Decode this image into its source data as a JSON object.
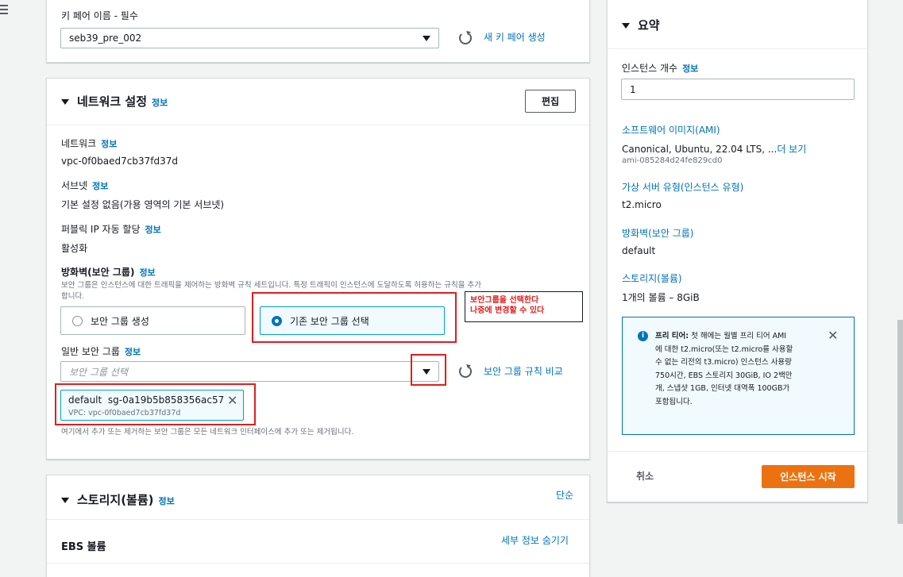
{
  "menu_icon": "hamburger-menu-icon",
  "keypair": {
    "label": "키 페어 이름 - 필수",
    "value": "seb39_pre_002",
    "create_link": "새 키 페어 생성"
  },
  "network": {
    "title": "네트워크 설정",
    "info": "정보",
    "edit_button": "편집",
    "network_label": "네트워크",
    "network_value": "vpc-0f0baed7cb37fd37d",
    "subnet_label": "서브넷",
    "subnet_value": "기본 설정 없음(가용 영역의 기본 서브넷)",
    "public_ip_label": "퍼블릭 IP 자동 할당",
    "public_ip_value": "활성화",
    "firewall_label": "방화벽(보안 그룹)",
    "firewall_desc_1": "보안 그룹은 인스턴스에 대한 트래픽을 제어하는 방화벽 규칙 세트입니다. 특정 트래픽이 인스턴스에 도달하도록 허용하는 규칙을 추가",
    "firewall_desc_2": "합니다.",
    "option_create": "보안 그룹 생성",
    "option_existing": "기존 보안 그룹 선택",
    "common_sg_label": "일반 보안 그룹",
    "sg_placeholder": "보안 그룹 선택",
    "compare_link": "보안 그룹 규칙 비교",
    "token_name": "default",
    "token_id": "sg-0a19b5b858356ac57",
    "token_vpc": "VPC: vpc-0f0baed7cb37fd37d",
    "footer_note": "여기에서 추가 또는 제거하는 보안 그룹은 모든 네트워크 인터페이스에 추가 또는 제거됩니다."
  },
  "annotation": {
    "line1": "보안그룹을 선택한다",
    "line2": "나중에 변경할 수 있다"
  },
  "storage": {
    "title": "스토리지(볼륨)",
    "info": "정보",
    "simple_link": "단순",
    "ebs_label": "EBS 볼륨",
    "hide_details_link": "세부 정보 숨기기"
  },
  "summary": {
    "title": "요약",
    "instance_count_label": "인스턴스 개수",
    "info": "정보",
    "instance_count_value": "1",
    "ami_label": "소프트웨어 이미지(AMI)",
    "ami_value": "Canonical, Ubuntu, 22.04 LTS, ...",
    "ami_more": "더 보기",
    "ami_id": "ami-085284d24fe829cd0",
    "type_label": "가상 서버 유형(인스턴스 유형)",
    "type_value": "t2.micro",
    "firewall_label": "방화벽(보안 그룹)",
    "firewall_value": "default",
    "storage_label": "스토리지(볼륨)",
    "storage_value": "1개의 볼륨 – 8GiB",
    "free_tier_bold": "프리 티어:",
    "free_tier_lines": [
      "첫 해에는 월별 프리 티어 AMI",
      "에 대한 t2.micro(또는 t2.micro를 사용할",
      "수 없는 리전의 t3.micro) 인스턴스 사용량",
      "750시간, EBS 스토리지 30GiB, IO 2백만",
      "개, 스냅샷 1GB, 인터넷 대역폭 100GB가",
      "포함됩니다."
    ],
    "cancel": "취소",
    "launch": "인스턴스 시작"
  },
  "colors": {
    "accent": "#0073bb",
    "launch": "#ec7211",
    "highlight_red": "#e31d1d"
  }
}
